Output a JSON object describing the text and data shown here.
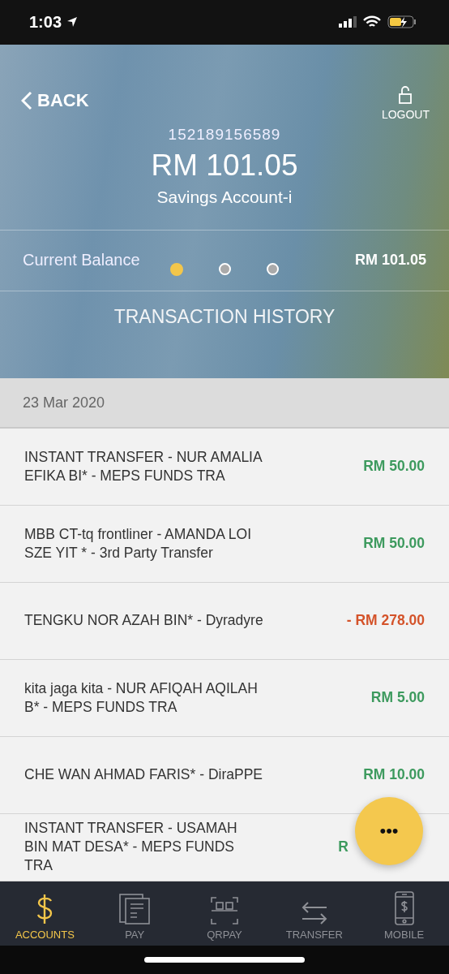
{
  "status_bar": {
    "time": "1:03"
  },
  "header": {
    "back": "BACK",
    "logout": "LOGOUT",
    "account_number": "152189156589",
    "amount": "RM 101.05",
    "account_type": "Savings Account-i"
  },
  "balance": {
    "label": "Current Balance",
    "value": "RM 101.05"
  },
  "pager": [
    {
      "selected": true
    },
    {
      "selected": false
    },
    {
      "selected": false
    }
  ],
  "section_title": "TRANSACTION HISTORY",
  "date": "23 Mar 2020",
  "transactions": [
    {
      "description": "INSTANT TRANSFER - NUR AMALIA EFIKA BI* - MEPS FUNDS TRA",
      "amount": "RM 50.00",
      "kind": "credit"
    },
    {
      "description": "MBB CT-tq frontliner - AMANDA LOI SZE YIT * - 3rd Party Transfer",
      "amount": "RM 50.00",
      "kind": "credit"
    },
    {
      "description": "TENGKU NOR AZAH BIN* - Dyradyre",
      "amount": "- RM 278.00",
      "kind": "debit"
    },
    {
      "description": "kita jaga kita - NUR AFIQAH AQILAH B* - MEPS FUNDS TRA",
      "amount": "RM 5.00",
      "kind": "credit"
    },
    {
      "description": "CHE WAN AHMAD FARIS* - DiraPPE",
      "amount": "RM 10.00",
      "kind": "credit"
    },
    {
      "description": "INSTANT TRANSFER - USAMAH BIN MAT DESA* - MEPS FUNDS TRA",
      "amount": "R",
      "kind": "credit"
    }
  ],
  "fab": {
    "label": "•••"
  },
  "nav": [
    {
      "label": "ACCOUNTS",
      "kind": "dollar",
      "selected": true
    },
    {
      "label": "PAY",
      "kind": "bill",
      "selected": false
    },
    {
      "label": "QRPAY",
      "kind": "qr",
      "selected": false
    },
    {
      "label": "TRANSFER",
      "kind": "arrows",
      "selected": false
    },
    {
      "label": "MOBILE",
      "kind": "phone",
      "selected": false
    }
  ]
}
